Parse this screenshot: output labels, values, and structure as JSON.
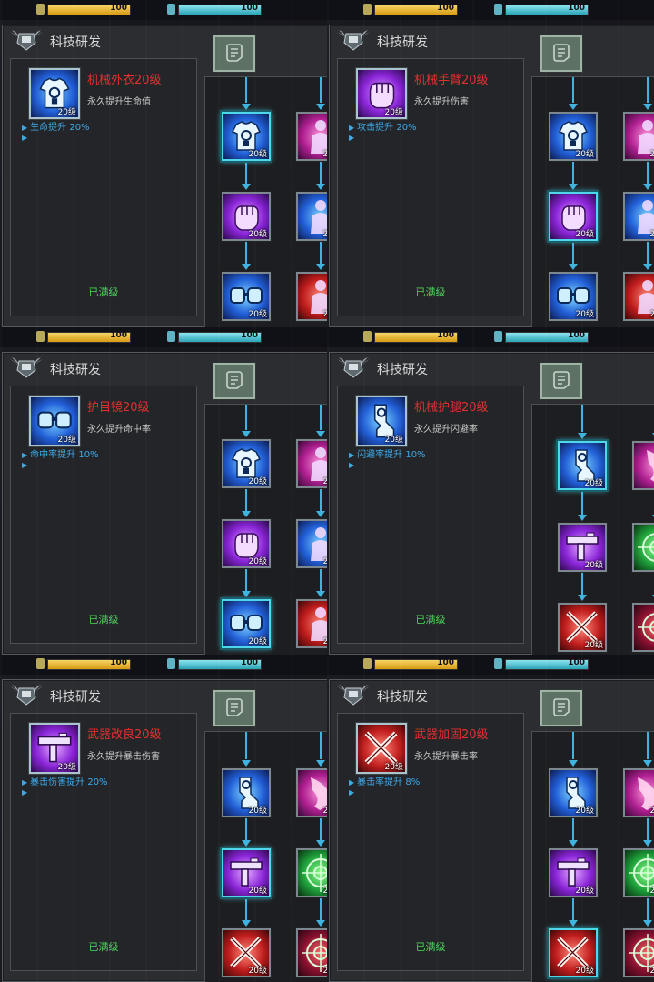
{
  "hud": {
    "hp_value": "100",
    "energy_value": "100"
  },
  "panel_title": "科技研发",
  "maxed_label": "已满级",
  "level_badge": "20级",
  "screens": [
    {
      "name": "机械外衣20级",
      "desc": "永久提升生命值",
      "bonus": "生命提升 20%",
      "icon": "shirt-icon",
      "color": "blue"
    },
    {
      "name": "机械手臂20级",
      "desc": "永久提升伤害",
      "bonus": "攻击提升 20%",
      "icon": "fist-icon",
      "color": "purple"
    },
    {
      "name": "护目镜20级",
      "desc": "永久提升命中率",
      "bonus": "命中率提升 10%",
      "icon": "goggles-icon",
      "color": "blue"
    },
    {
      "name": "机械护腿20级",
      "desc": "永久提升闪避率",
      "bonus": "闪避率提升 10%",
      "icon": "leg-icon",
      "color": "blue"
    },
    {
      "name": "武器改良20级",
      "desc": "永久提升暴击伤害",
      "bonus": "暴击伤害提升 20%",
      "icon": "gun-icon",
      "color": "purple"
    },
    {
      "name": "武器加固20级",
      "desc": "永久提升暴击率",
      "bonus": "暴击率提升 8%",
      "icon": "crossed-guns-icon",
      "color": "red"
    }
  ],
  "colors": {
    "accent": "#4fd6ea",
    "name_red": "#e23030",
    "bonus_blue": "#3fa9e8",
    "maxed_green": "#4fd35a"
  }
}
